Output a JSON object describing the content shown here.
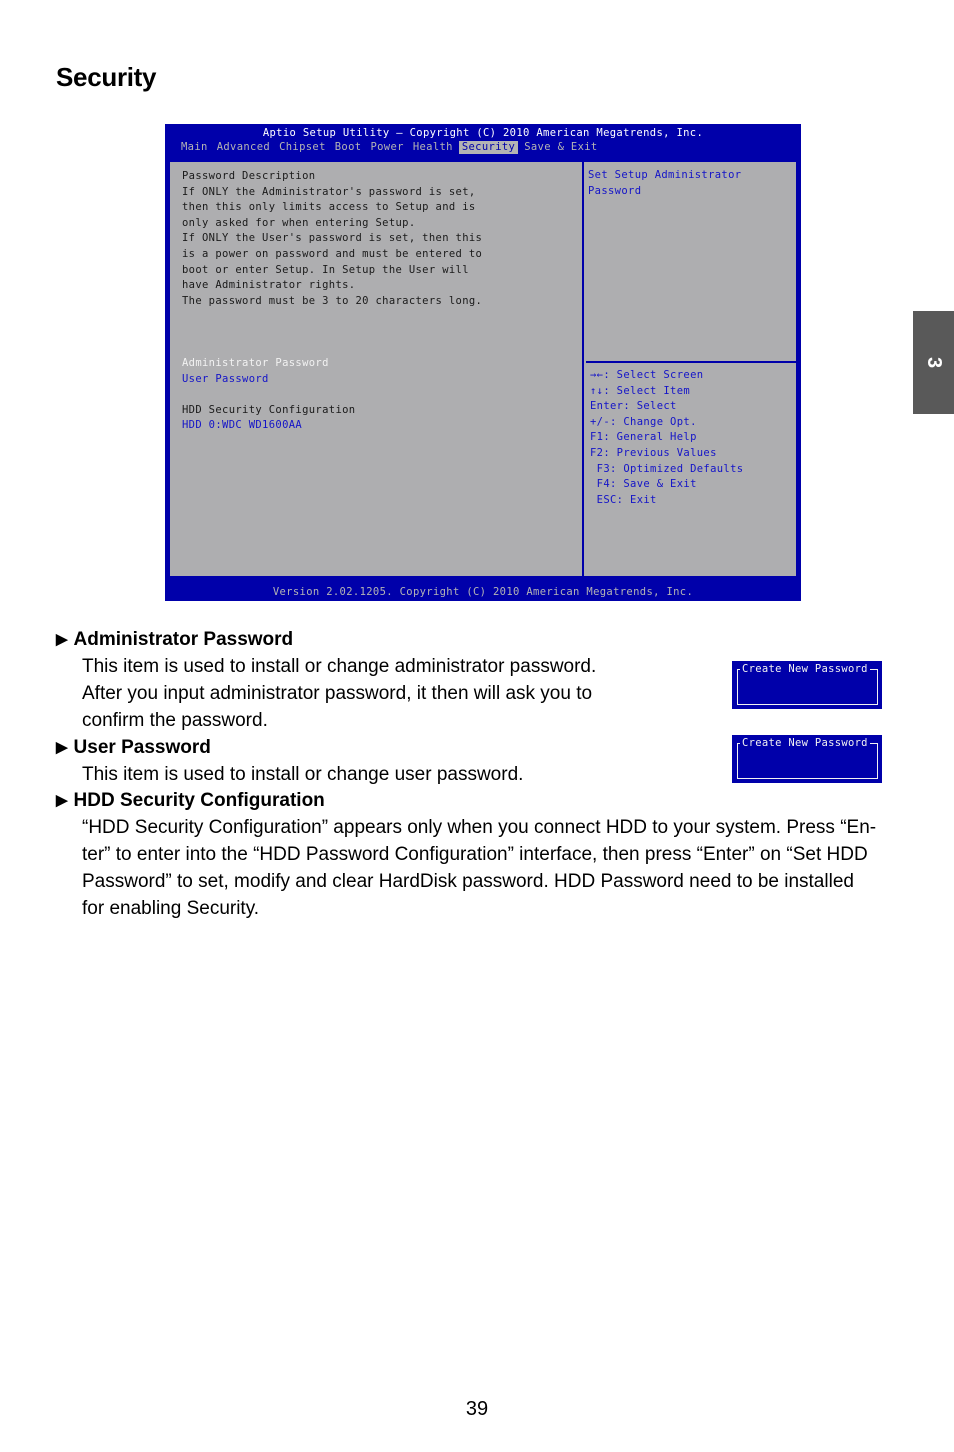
{
  "page": {
    "title": "Security",
    "chapter_tab": "3",
    "page_number": "39"
  },
  "bios": {
    "title": "Aptio Setup Utility – Copyright (C) 2010 American Megatrends, Inc.",
    "tabs": [
      {
        "label": "Main",
        "active": false
      },
      {
        "label": "Advanced",
        "active": false
      },
      {
        "label": "Chipset",
        "active": false
      },
      {
        "label": "Boot",
        "active": false
      },
      {
        "label": "Power",
        "active": false
      },
      {
        "label": "Health",
        "active": false
      },
      {
        "label": "Security",
        "active": true
      },
      {
        "label": "Save & Exit",
        "active": false
      }
    ],
    "description_lines": [
      "Password Description",
      "",
      "If ONLY the Administrator's password is set,",
      "then this only limits access to Setup and is",
      "only asked for when entering Setup.",
      "If ONLY the User's password is set, then this",
      "is a power on password and must be entered to",
      "boot or enter Setup. In Setup the User will",
      "have Administrator rights.",
      "The password must be 3 to 20 characters long."
    ],
    "menu_items": {
      "admin_password": "Administrator Password",
      "user_password": "User Password",
      "hdd_security_heading": "HDD Security Configuration",
      "hdd_device": "HDD 0:WDC WD1600AA"
    },
    "help_text": [
      "Set Setup Administrator",
      "Password"
    ],
    "key_help": [
      "→←: Select Screen",
      "↑↓: Select Item",
      "Enter: Select",
      "+/-: Change Opt.",
      "F1: General Help",
      "F2: Previous Values",
      " F3: Optimized Defaults",
      " F4: Save & Exit",
      " ESC: Exit"
    ],
    "footer": "Version 2.02.1205. Copyright (C) 2010 American Megatrends, Inc."
  },
  "sections": {
    "admin": {
      "heading": "Administrator Password",
      "lines": [
        "This item is used to install or change administrator password.",
        "After you input administrator password, it then will ask you to",
        "confirm the password."
      ],
      "popup_title": "Create New Password"
    },
    "user": {
      "heading": "User Password",
      "lines": [
        "This item is used to install or change user password."
      ],
      "popup_title": "Create New Password"
    },
    "hdd": {
      "heading": "HDD Security Configuration",
      "lines": [
        "“HDD Security Configuration” appears only when you connect HDD to your system. Press “En-",
        "ter” to enter into the “HDD Password Configuration” interface, then press “Enter” on “Set HDD",
        "Password” to set, modify and clear HardDisk password. HDD Password need to be installed",
        "for enabling Security."
      ]
    },
    "arrow_glyph": "▶"
  }
}
